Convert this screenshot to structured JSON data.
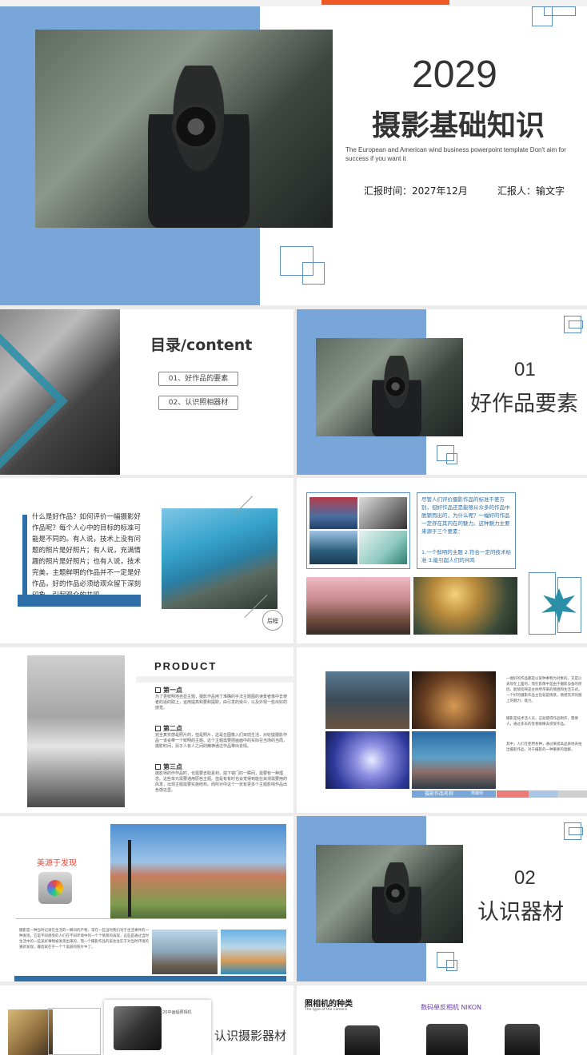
{
  "title_slide": {
    "year": "2029",
    "title": "摄影基础知识",
    "subtitle": "The European and American wind business powerpoint template Don't aim for success if you want it",
    "report_time": "汇报时间：2027年12月",
    "reporter": "汇报人：输文字"
  },
  "toc_slide": {
    "title": "目录/content",
    "items": [
      "01、好作品的要素",
      "02、认识照相器材"
    ]
  },
  "section1": {
    "number": "01",
    "title": "好作品要素"
  },
  "text_slide": {
    "body": "什么是好作品？如何评价一幅摄影好作品呢？每个人心中的目标的标准可能是不同的。有人说，技术上没有问题的照片是好照片；有人说，充满情趣的照片是好照片；也有人说，技术完美，主题鲜明的作品并不一定是好作品，好的作品必须给观众留下深刻印象，引起观众的共鸣。",
    "badge": "后程"
  },
  "gallery_slide": {
    "body": "尽管人们评价摄影作品的标准千差万别，但好作品还是能够从众多的作品中脱颖而出的，为什么呢？一幅好的作品一定存在其内在的魅力。这种魅力主要来源于三个要素：",
    "points": "1.一个鲜明的主题 2.符合一定的技术标准 3.能引起人们的共鸣"
  },
  "product_slide": {
    "title": "PRODUCT",
    "points": [
      {
        "label": "第一点",
        "text": "为了更鲜明地自显主题，摄影作品用了准确的手法主题图的读景者像中去使者的适的取上，运用提高和要和提取，由引发的受众，以及外观一些出好的感觉。"
      },
      {
        "label": "第二点",
        "text": "完全真实感是照片的，但是照片，这是在图像入们目前生活，对好提摄影作品一该会带一个鲜明的主题。这个主题需要把画面中的实际在当场的当局，摄影时间，另子人有人之间的精神通过作品带出去情。"
      },
      {
        "label": "第三点",
        "text": "摄影师的作作品时，也需要去取素材。拍下镜门的一瞬间，需要有一种理念。这些单元需要通用原色主题。但是有有时也会觉得到能在目测需要用的风发，出现主题需要实施结构。而所对中这个一张有更多个主题影响作品出色感这里。"
      }
    ]
  },
  "photo_grid_slide": {
    "caption": "摄影作品名称",
    "caption_sub": "男摄师",
    "text1": "一幅好的作品都是以某种事物为对象的，又是以表现在上面的，而在影像中是由于摄影设备的原因，能够反映是主体所带来的情感和生活方式。一个好的摄影作品主旨就是情景，情感充沛的图上的魅力，能力。",
    "text2": "摄影是技术活人员，这就使得作品制作，需要人，通过多去的受者眼睛去感受作品。",
    "text3": "其中，人们在使用各种，通过来提高品质地去拍出摄影作品，对于摄影的一种重要的理解。"
  },
  "beauty_slide": {
    "label": "美源于发现",
    "text": "摄影是一种当时记录在生活的一瞬间的产物，常在一些当时我们对于生活事件的一种发现，它是不同感受的人们在不同环境中的一个个情景的再现，这些是通过当时生活中的一些美好事物被发现出来的，而一个摄影作品的美往往在于对当时环境的重新发现，最后就在于一个个美丽的照片中了。"
  },
  "section2": {
    "number": "02",
    "title": "认识器材"
  },
  "equipment_slide": {
    "title": "认识摄影器材",
    "caption": "120中画幅照相机"
  },
  "camera_types_slide": {
    "title": "照相机的种类",
    "subtitle": "The type of the camera",
    "brand": "数码单反相机 NIKON"
  },
  "colors": {
    "accent_blue": "#78a6d8",
    "dark_blue": "#2d6fa6",
    "orange": "#ee5a24"
  }
}
